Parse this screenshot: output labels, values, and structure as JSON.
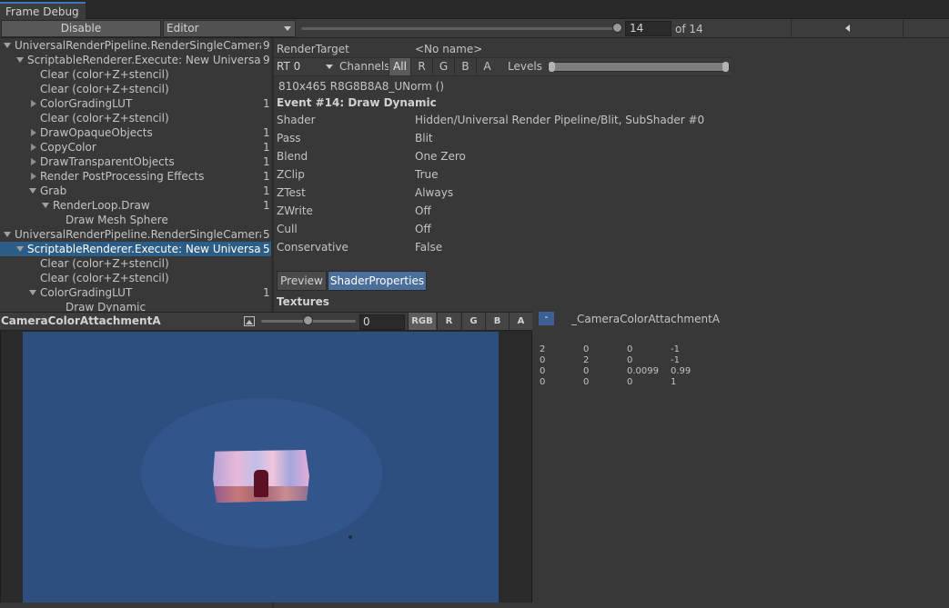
{
  "window": {
    "tab_title": "Frame Debug"
  },
  "toolbar": {
    "disable_label": "Disable",
    "target_dropdown": "Editor",
    "event_value": "14",
    "event_of": "of 14"
  },
  "tree": {
    "rows": [
      {
        "label": "UniversalRenderPipeline.RenderSingleCamera: I",
        "count": "9",
        "indent": 0,
        "arrow": "down",
        "selected": false
      },
      {
        "label": "ScriptableRenderer.Execute: New Universal R",
        "count": "9",
        "indent": 1,
        "arrow": "down",
        "selected": false
      },
      {
        "label": "Clear (color+Z+stencil)",
        "count": "",
        "indent": 2,
        "arrow": "none",
        "selected": false
      },
      {
        "label": "Clear (color+Z+stencil)",
        "count": "",
        "indent": 2,
        "arrow": "none",
        "selected": false
      },
      {
        "label": "ColorGradingLUT",
        "count": "1",
        "indent": 2,
        "arrow": "right",
        "selected": false
      },
      {
        "label": "Clear (color+Z+stencil)",
        "count": "",
        "indent": 2,
        "arrow": "none",
        "selected": false
      },
      {
        "label": "DrawOpaqueObjects",
        "count": "1",
        "indent": 2,
        "arrow": "right",
        "selected": false
      },
      {
        "label": "CopyColor",
        "count": "1",
        "indent": 2,
        "arrow": "right",
        "selected": false
      },
      {
        "label": "DrawTransparentObjects",
        "count": "1",
        "indent": 2,
        "arrow": "right",
        "selected": false
      },
      {
        "label": "Render PostProcessing Effects",
        "count": "1",
        "indent": 2,
        "arrow": "right",
        "selected": false
      },
      {
        "label": "Grab",
        "count": "1",
        "indent": 2,
        "arrow": "down",
        "selected": false
      },
      {
        "label": "RenderLoop.Draw",
        "count": "1",
        "indent": 3,
        "arrow": "down",
        "selected": false
      },
      {
        "label": "Draw Mesh Sphere",
        "count": "",
        "indent": 4,
        "arrow": "none",
        "selected": false
      },
      {
        "label": "UniversalRenderPipeline.RenderSingleCamera: (",
        "count": "5",
        "indent": 0,
        "arrow": "down",
        "selected": false
      },
      {
        "label": "ScriptableRenderer.Execute: New Universal R",
        "count": "5",
        "indent": 1,
        "arrow": "down",
        "selected": true
      },
      {
        "label": "Clear (color+Z+stencil)",
        "count": "",
        "indent": 2,
        "arrow": "none",
        "selected": false
      },
      {
        "label": "Clear (color+Z+stencil)",
        "count": "",
        "indent": 2,
        "arrow": "none",
        "selected": false
      },
      {
        "label": "ColorGradingLUT",
        "count": "1",
        "indent": 2,
        "arrow": "down",
        "selected": false
      },
      {
        "label": "Draw Dynamic",
        "count": "",
        "indent": 4,
        "arrow": "none",
        "selected": false
      }
    ]
  },
  "details": {
    "render_target_label": "RenderTarget",
    "render_target_value": "<No name>",
    "rt_dropdown": "RT 0",
    "channels_label": "Channels",
    "channels": [
      "All",
      "R",
      "G",
      "B",
      "A"
    ],
    "levels_label": "Levels",
    "format": "810x465 R8G8B8A8_UNorm ()",
    "event_title": "Event #14: Draw Dynamic",
    "properties": [
      {
        "label": "Shader",
        "value": "Hidden/Universal Render Pipeline/Blit, SubShader #0"
      },
      {
        "label": "Pass",
        "value": "Blit"
      },
      {
        "label": "Blend",
        "value": "One Zero"
      },
      {
        "label": "ZClip",
        "value": "True"
      },
      {
        "label": "ZTest",
        "value": "Always"
      },
      {
        "label": "ZWrite",
        "value": "Off"
      },
      {
        "label": "Cull",
        "value": "Off"
      },
      {
        "label": "Conservative",
        "value": "False"
      }
    ],
    "tabs": [
      "Preview",
      "ShaderProperties"
    ],
    "textures_label": "Textures"
  },
  "preview": {
    "title": "CameraColorAttachmentA",
    "mip_value": "0",
    "buttons": [
      "RGB",
      "R",
      "G",
      "B",
      "A"
    ]
  },
  "texture": {
    "dash": "-",
    "name": "_CameraColorAttachmentA",
    "matrix": [
      [
        "2",
        "0",
        "0",
        "-1"
      ],
      [
        "0",
        "2",
        "0",
        "-1"
      ],
      [
        "0",
        "0",
        "0.0099",
        "0.99"
      ],
      [
        "0",
        "0",
        "0",
        "1"
      ]
    ]
  },
  "colors": {
    "selection": "#2c5d87",
    "active_tab": "#4a6f9a",
    "preview_bg": "#2d4e7f"
  }
}
